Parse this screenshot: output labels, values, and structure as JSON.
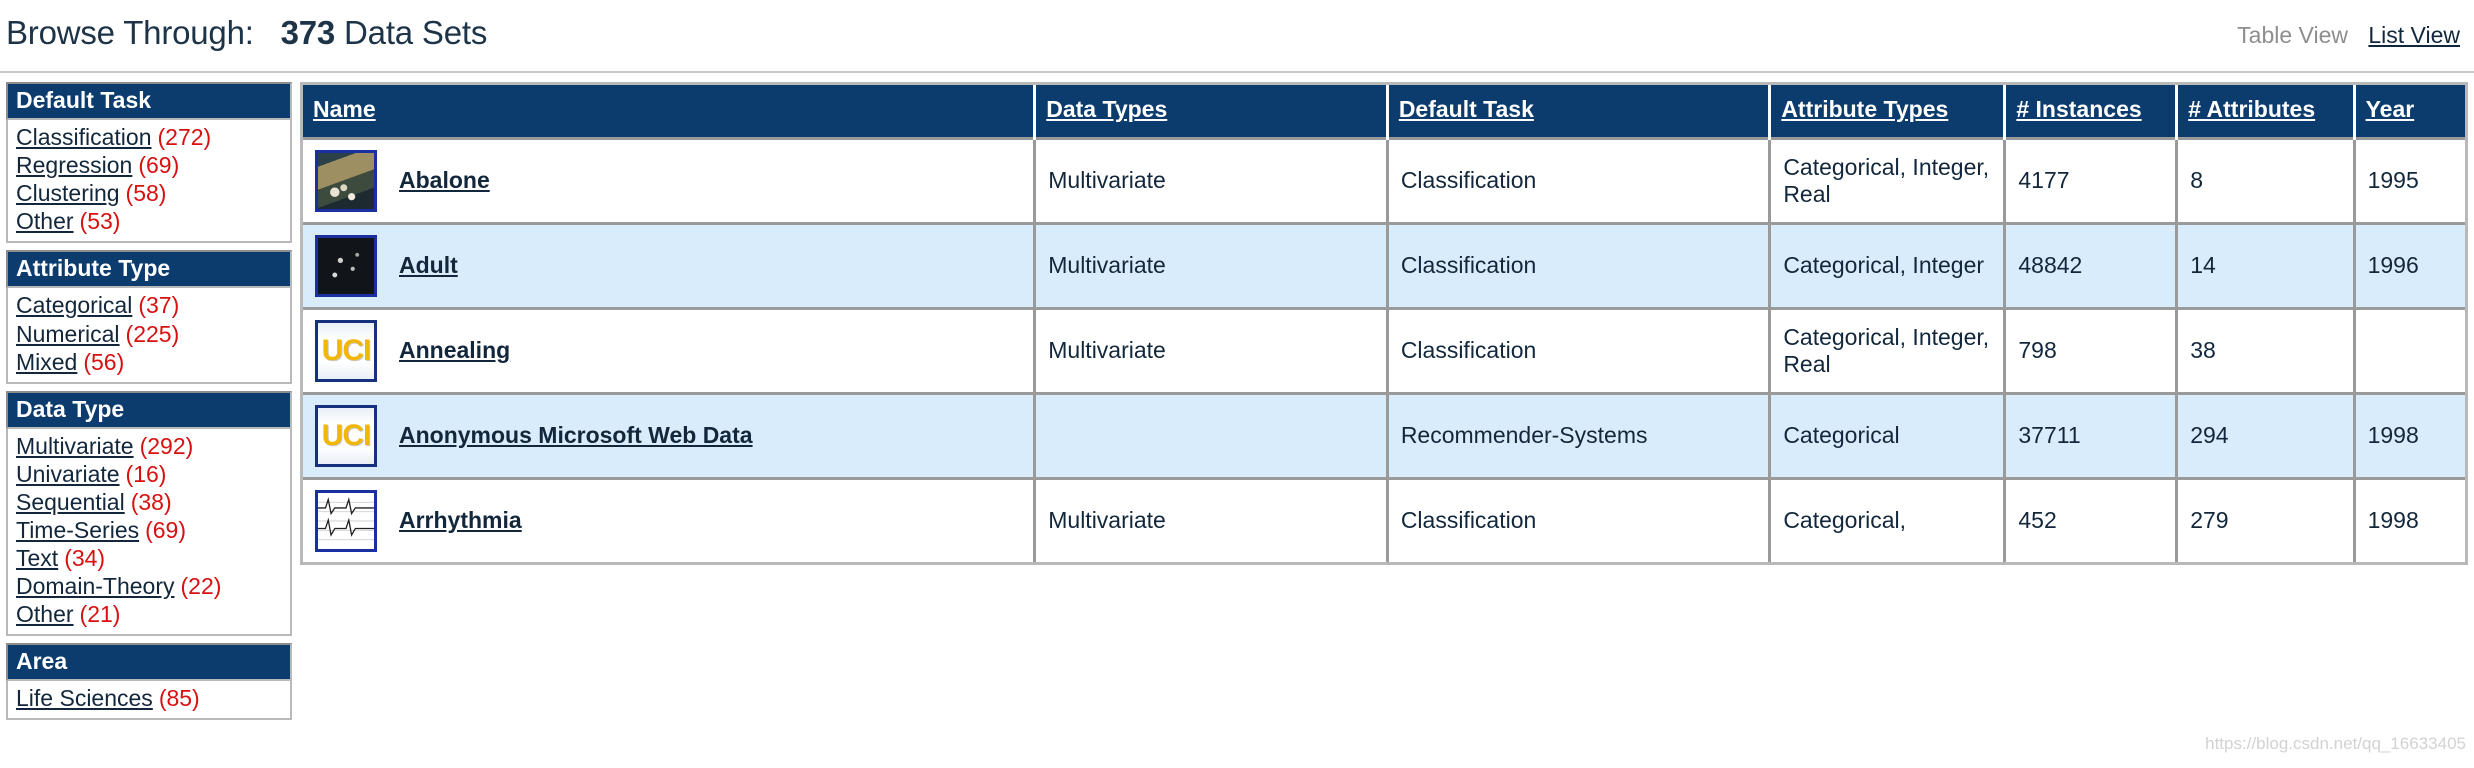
{
  "header": {
    "browse_label": "Browse Through:",
    "count": "373",
    "unit_label": "Data Sets",
    "table_view": "Table View",
    "list_view": "List View"
  },
  "sidebar": {
    "facets": [
      {
        "title": "Default Task",
        "items": [
          {
            "label": "Classification",
            "count": "(272)"
          },
          {
            "label": "Regression",
            "count": "(69)"
          },
          {
            "label": "Clustering",
            "count": "(58)"
          },
          {
            "label": "Other",
            "count": "(53)"
          }
        ]
      },
      {
        "title": "Attribute Type",
        "items": [
          {
            "label": "Categorical",
            "count": "(37)"
          },
          {
            "label": "Numerical",
            "count": "(225)"
          },
          {
            "label": "Mixed",
            "count": "(56)"
          }
        ]
      },
      {
        "title": "Data Type",
        "items": [
          {
            "label": "Multivariate",
            "count": "(292)"
          },
          {
            "label": "Univariate",
            "count": "(16)"
          },
          {
            "label": "Sequential",
            "count": "(38)"
          },
          {
            "label": "Time-Series",
            "count": "(69)"
          },
          {
            "label": "Text",
            "count": "(34)"
          },
          {
            "label": "Domain-Theory",
            "count": "(22)"
          },
          {
            "label": "Other",
            "count": "(21)"
          }
        ]
      },
      {
        "title": "Area",
        "items": [
          {
            "label": "Life Sciences",
            "count": "(85)"
          }
        ]
      }
    ]
  },
  "table": {
    "columns": [
      {
        "label": "Name"
      },
      {
        "label": "Data Types"
      },
      {
        "label": "Default Task"
      },
      {
        "label": "Attribute Types"
      },
      {
        "label": "# Instances"
      },
      {
        "label": "# Attributes"
      },
      {
        "label": "Year"
      }
    ],
    "rows": [
      {
        "thumb": "abalone-thumbnail",
        "name": "Abalone",
        "data_types": "Multivariate",
        "default_task": "Classification",
        "attribute_types": "Categorical, Integer, Real",
        "instances": "4177",
        "attributes": "8",
        "year": "1995"
      },
      {
        "thumb": "adult-thumbnail",
        "name": "Adult",
        "data_types": "Multivariate",
        "default_task": "Classification",
        "attribute_types": "Categorical, Integer",
        "instances": "48842",
        "attributes": "14",
        "year": "1996"
      },
      {
        "thumb": "uci-logo-thumbnail",
        "name": "Annealing",
        "data_types": "Multivariate",
        "default_task": "Classification",
        "attribute_types": "Categorical, Integer, Real",
        "instances": "798",
        "attributes": "38",
        "year": ""
      },
      {
        "thumb": "uci-logo-thumbnail",
        "name": "Anonymous Microsoft Web Data",
        "data_types": "",
        "default_task": "Recommender-Systems",
        "attribute_types": "Categorical",
        "instances": "37711",
        "attributes": "294",
        "year": "1998"
      },
      {
        "thumb": "ecg-thumbnail",
        "name": "Arrhythmia",
        "data_types": "Multivariate",
        "default_task": "Classification",
        "attribute_types": "Categorical,",
        "instances": "452",
        "attributes": "279",
        "year": "1998"
      }
    ]
  },
  "uci_logo_text": "UCI",
  "watermark": "https://blog.csdn.net/qq_16633405"
}
